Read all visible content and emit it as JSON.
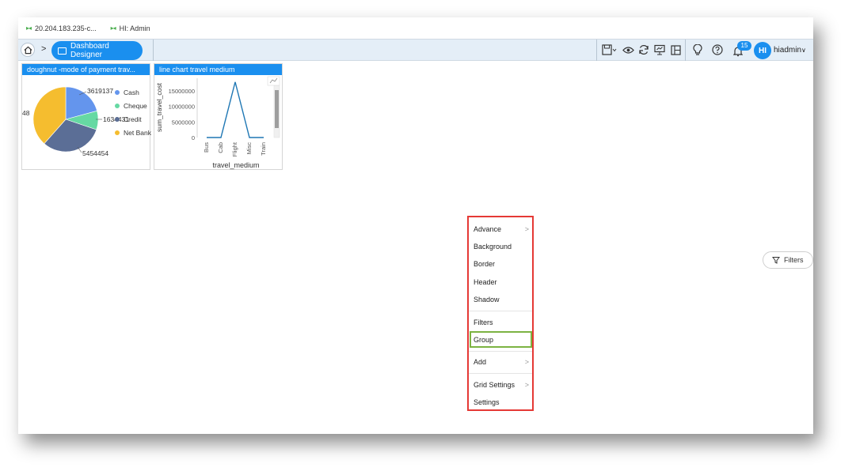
{
  "tabs": [
    {
      "label": "20.204.183.235-c..."
    },
    {
      "label": "HI: Admin"
    }
  ],
  "breadcrumb": {
    "current": "Dashboard Designer"
  },
  "toolbar": {
    "icons": [
      "save-icon",
      "eye-icon",
      "refresh-icon",
      "presentation-icon",
      "layout-icon",
      "bulb-icon",
      "help-icon",
      "bell-icon"
    ],
    "notification_count": "15",
    "avatar_initials": "HI",
    "username": "hiadmin"
  },
  "widgets": {
    "doughnut": {
      "title": "doughnut -mode of payment trav...",
      "labels": [
        "3619137",
        "1634431",
        "5454454",
        "48"
      ],
      "legend": [
        "Cash",
        "Cheque",
        "Credit",
        "Net Bank"
      ],
      "colors": [
        "#6495ed",
        "#66d9a3",
        "#5b6e96",
        "#f5bd2f"
      ]
    },
    "line": {
      "title": "line chart travel medium",
      "ylabel": "sum_travel_cost",
      "xlabel": "travel_medium",
      "yticks": [
        "15000000",
        "10000000",
        "5000000",
        "0"
      ]
    }
  },
  "chart_data": [
    {
      "type": "pie",
      "title": "doughnut -mode of payment trav...",
      "categories": [
        "Cash",
        "Cheque",
        "Credit",
        "Net Bank"
      ],
      "values": [
        3619137,
        1634431,
        5454454,
        6700000
      ],
      "colors": [
        "#6495ed",
        "#66d9a3",
        "#5b6e96",
        "#f5bd2f"
      ]
    },
    {
      "type": "line",
      "title": "line chart travel medium",
      "xlabel": "travel_medium",
      "ylabel": "sum_travel_cost",
      "categories": [
        "Bus",
        "Cab",
        "Flight",
        "Misc",
        "Train"
      ],
      "values": [
        0,
        0,
        17800000,
        0,
        0
      ],
      "ylim": [
        0,
        19000000
      ],
      "color": "#1f77b4"
    }
  ],
  "context_menu": {
    "items": [
      {
        "label": "Advance",
        "submenu": true
      },
      {
        "label": "Background",
        "submenu": false
      },
      {
        "label": "Border",
        "submenu": false
      },
      {
        "label": "Header",
        "submenu": false
      },
      {
        "label": "Shadow",
        "submenu": false
      },
      {
        "label": "Filters",
        "submenu": false
      },
      {
        "label": "Group",
        "submenu": false
      },
      {
        "label": "Add",
        "submenu": true
      },
      {
        "label": "Grid Settings",
        "submenu": true
      },
      {
        "label": "Settings",
        "submenu": false
      }
    ],
    "highlighted": "Group",
    "border_color": "#e53935",
    "highlight_color": "#7cb342"
  },
  "filters_button": {
    "label": "Filters"
  }
}
